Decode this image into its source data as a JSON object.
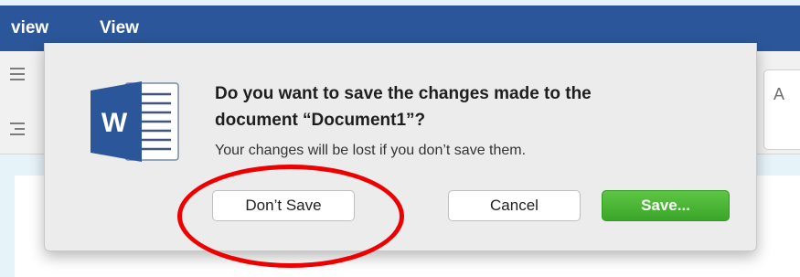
{
  "ribbon": {
    "tabs": [
      {
        "label": "view"
      },
      {
        "label": "View"
      }
    ],
    "color": "#2b579a"
  },
  "toolbar": {
    "icons": [
      "list-icon",
      "indent-icon"
    ],
    "right_glyph": "A"
  },
  "dialog": {
    "icon": "word-app-icon",
    "icon_letter": "W",
    "title_line1": "Do you want to save the changes made to the",
    "title_line2": "document “Document1”?",
    "message": "Your changes will be lost if you don’t save them.",
    "buttons": {
      "dont_save": "Don’t Save",
      "cancel": "Cancel",
      "save": "Save..."
    },
    "colors": {
      "save_button": "#3aa62a",
      "highlight": "#ee0000"
    }
  }
}
